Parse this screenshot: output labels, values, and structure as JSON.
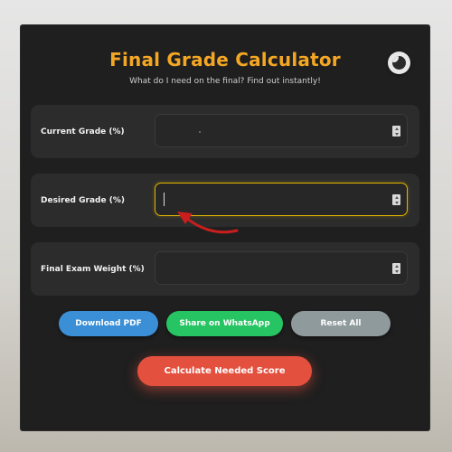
{
  "header": {
    "title": "Final Grade Calculator",
    "subtitle": "What do I need on the final? Find out instantly!"
  },
  "theme_toggle": {
    "icon": "moon-icon"
  },
  "fields": [
    {
      "label": "Current Grade (%)",
      "value": "",
      "state": "default"
    },
    {
      "label": "Desired Grade (%)",
      "value": "",
      "state": "focused"
    },
    {
      "label": "Final Exam Weight (%)",
      "value": "",
      "state": "default"
    }
  ],
  "actions": {
    "download_pdf": "Download PDF",
    "share_whatsapp": "Share on WhatsApp",
    "reset_all": "Reset All",
    "calculate": "Calculate Needed Score"
  },
  "colors": {
    "accent": "#f4a724",
    "focus_border": "#e0b300",
    "pdf": "#3b8fd6",
    "whatsapp": "#27c463",
    "reset": "#8f9a9c",
    "calculate": "#e4503e",
    "annotation_arrow": "#c81e1e"
  }
}
